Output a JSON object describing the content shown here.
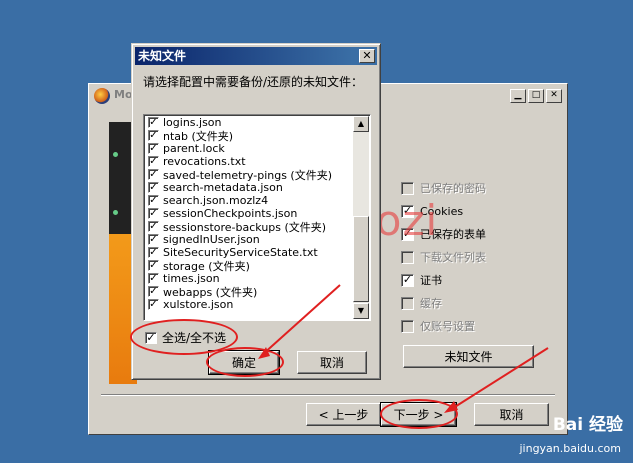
{
  "main_window": {
    "title": "Moz",
    "options": [
      {
        "label": "已保存的密码",
        "checked": false,
        "enabled": false
      },
      {
        "label": "Cookies",
        "checked": true,
        "enabled": true
      },
      {
        "label": "已保存的表单",
        "checked": true,
        "enabled": true
      },
      {
        "label": "下载文件列表",
        "checked": false,
        "enabled": false
      },
      {
        "label": "证书",
        "checked": true,
        "enabled": true
      },
      {
        "label": "缓存",
        "checked": false,
        "enabled": false
      },
      {
        "label": "仅账号设置",
        "checked": false,
        "enabled": false
      }
    ],
    "unknown_files_button": "未知文件",
    "back_button": "< 上一步",
    "next_button": "下一步 >",
    "cancel_button": "取消"
  },
  "dialog": {
    "title": "未知文件",
    "close_glyph": "✕",
    "prompt": "请选择配置中需要备份/还原的未知文件：",
    "files": [
      {
        "name": "logins.json",
        "checked": true
      },
      {
        "name": "ntab (文件夹)",
        "checked": true
      },
      {
        "name": "parent.lock",
        "checked": true
      },
      {
        "name": "revocations.txt",
        "checked": true
      },
      {
        "name": "saved-telemetry-pings (文件夹)",
        "checked": true
      },
      {
        "name": "search-metadata.json",
        "checked": true
      },
      {
        "name": "search.json.mozlz4",
        "checked": true
      },
      {
        "name": "sessionCheckpoints.json",
        "checked": true
      },
      {
        "name": "sessionstore-backups (文件夹)",
        "checked": true
      },
      {
        "name": "signedInUser.json",
        "checked": true
      },
      {
        "name": "SiteSecurityServiceState.txt",
        "checked": true
      },
      {
        "name": "storage (文件夹)",
        "checked": true
      },
      {
        "name": "times.json",
        "checked": true
      },
      {
        "name": "webapps (文件夹)",
        "checked": true
      },
      {
        "name": "xulstore.json",
        "checked": true
      }
    ],
    "select_all_label": "全选/全不选",
    "select_all_checked": true,
    "ok_button": "确定",
    "cancel_button": "取消"
  },
  "watermark": "ZD guozi",
  "site": {
    "logo": "Bai 经验",
    "url": "jingyan.baidu.com"
  },
  "colors": {
    "desktop": "#3a6ea5",
    "titlebar": "#0a246a",
    "annotation": "#e02020"
  }
}
